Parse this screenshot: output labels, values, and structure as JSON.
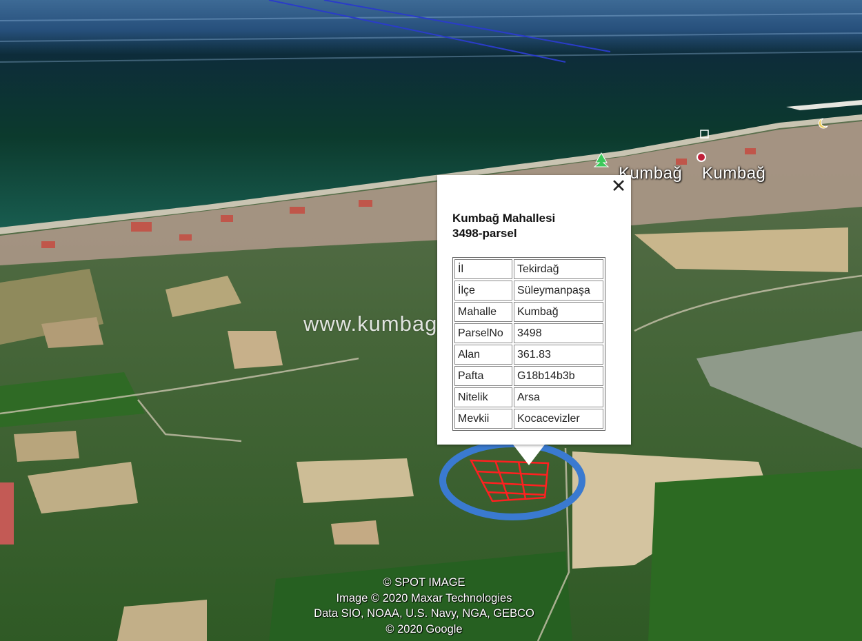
{
  "colors": {
    "sea": "#0e3b2c",
    "sky_water": "#2d5a86",
    "farmland": "#3f6b2c",
    "parcel_outline": "#ff2020",
    "highlight_ring": "#3a7ad0",
    "balloon_bg": "#ffffff"
  },
  "map": {
    "place_labels": [
      "Kumbağ",
      "Kumbağ"
    ],
    "watermark": "www.kumbag.com.tr",
    "icons": [
      "park-icon",
      "poi-marker-icon",
      "info-square-icon",
      "moon-icon"
    ]
  },
  "balloon": {
    "title_line1": "Kumbağ Mahallesi",
    "title_line2": "3498-parsel",
    "close_label": "✕",
    "rows": [
      {
        "key": "İl",
        "value": "Tekirdağ"
      },
      {
        "key": "İlçe",
        "value": "Süleymanpaşa"
      },
      {
        "key": "Mahalle",
        "value": "Kumbağ"
      },
      {
        "key": "ParselNo",
        "value": "3498"
      },
      {
        "key": "Alan",
        "value": "361.83"
      },
      {
        "key": "Pafta",
        "value": "G18b14b3b"
      },
      {
        "key": "Nitelik",
        "value": "Arsa"
      },
      {
        "key": "Mevkii",
        "value": "Kocacevizler"
      }
    ]
  },
  "attribution": [
    "© SPOT IMAGE",
    "Image © 2020 Maxar Technologies",
    "Data SIO, NOAA, U.S. Navy, NGA, GEBCO",
    "© 2020 Google"
  ]
}
